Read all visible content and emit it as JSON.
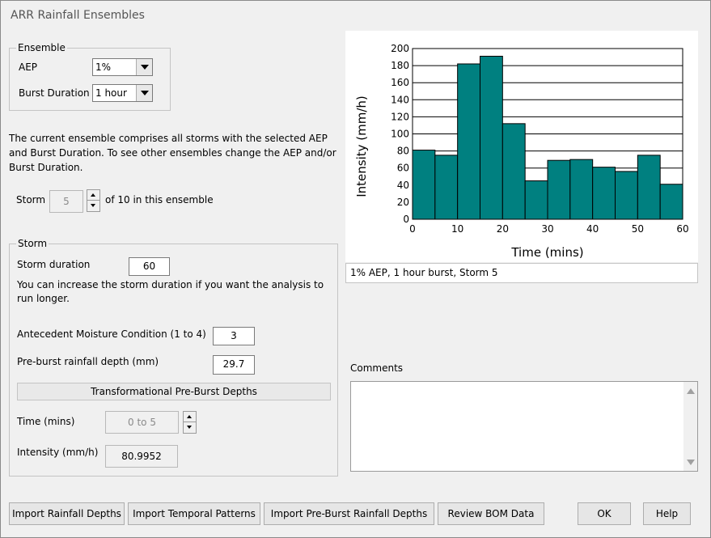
{
  "window": {
    "title": "ARR Rainfall Ensembles"
  },
  "ensemble": {
    "legend": "Ensemble",
    "aep_label": "AEP",
    "aep_value": "1%",
    "burst_label": "Burst Duration",
    "burst_value": "1 hour"
  },
  "description": "The current ensemble comprises all storms with the selected AEP and Burst Duration.  To see other ensembles change the AEP and/or Burst Duration.",
  "storm_selector": {
    "label": "Storm",
    "value": "5",
    "suffix": "of 10 in this ensemble"
  },
  "storm": {
    "legend": "Storm",
    "duration_label": "Storm duration",
    "duration_value": "60",
    "note": "You can increase the storm duration if you want the analysis to run longer.",
    "amc_label": "Antecedent Moisture Condition (1 to 4)",
    "amc_value": "3",
    "preburst_label": "Pre-burst rainfall depth (mm)",
    "preburst_value": "29.7",
    "transform_button": "Transformational Pre-Burst Depths",
    "time_label": "Time (mins)",
    "time_value": "0 to 5",
    "intensity_label": "Intensity (mm/h)",
    "intensity_value": "80.9952"
  },
  "chart_data": {
    "type": "bar",
    "xlabel": "Time (mins)",
    "ylabel": "Intensity (mm/h)",
    "x_edges": [
      0,
      5,
      10,
      15,
      20,
      25,
      30,
      35,
      40,
      45,
      50,
      55,
      60
    ],
    "values": [
      81,
      75,
      182,
      191,
      112,
      45,
      69,
      70,
      61,
      56,
      75,
      41
    ],
    "xlim": [
      0,
      60
    ],
    "ylim": [
      0,
      200
    ],
    "xticks": [
      0,
      10,
      20,
      30,
      40,
      50,
      60
    ],
    "yticks": [
      0,
      20,
      40,
      60,
      80,
      100,
      120,
      140,
      160,
      180,
      200
    ],
    "grid": "horizontal",
    "bar_color": "#008080"
  },
  "chart_caption": "1% AEP, 1 hour burst, Storm 5",
  "comments_label": "Comments",
  "comments_value": "",
  "buttons": {
    "import_rainfall": "Import Rainfall Depths",
    "import_temporal": "Import Temporal Patterns",
    "import_preburst": "Import Pre-Burst Rainfall Depths",
    "review_bom": "Review BOM Data",
    "ok": "OK",
    "help": "Help"
  }
}
